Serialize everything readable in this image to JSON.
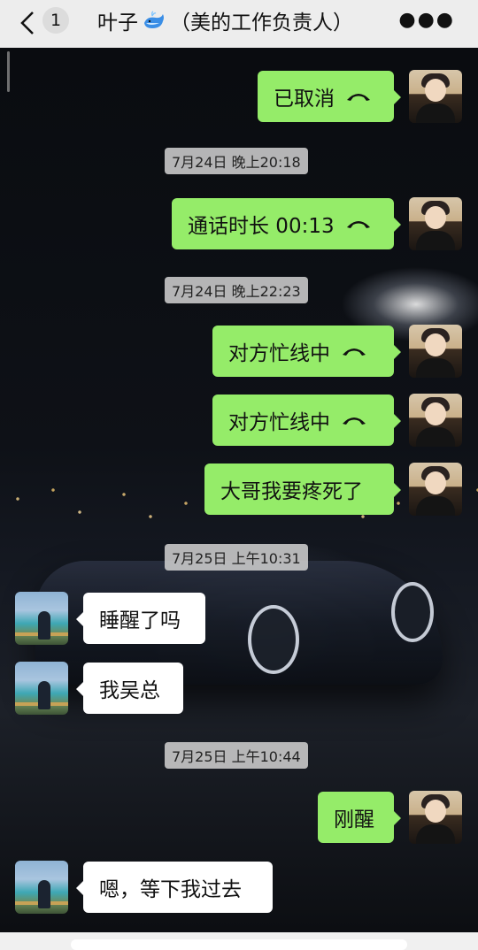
{
  "header": {
    "back_icon": "chevron-left-icon",
    "unread_count": "1",
    "title_name": "叶子",
    "title_emoji": "whale-icon",
    "title_note": "（美的工作负责人）",
    "more_icon": "ellipsis-icon"
  },
  "colors": {
    "self_bubble": "#95ec69",
    "other_bubble": "#ffffff",
    "timestamp_bg": "#cdcdcd",
    "header_bg": "#ededed"
  },
  "messages": [
    {
      "side": "right",
      "text": "已取消",
      "icon": "phone-hangup-icon"
    },
    {
      "stamp": "7月24日 晚上20:18"
    },
    {
      "side": "right",
      "text": "通话时长 00:13",
      "icon": "phone-hangup-icon"
    },
    {
      "stamp": "7月24日 晚上22:23"
    },
    {
      "side": "right",
      "text": "对方忙线中",
      "icon": "phone-hangup-icon"
    },
    {
      "side": "right",
      "text": "对方忙线中",
      "icon": "phone-hangup-icon"
    },
    {
      "side": "right",
      "text": "大哥我要疼死了"
    },
    {
      "stamp": "7月25日 上午10:31"
    },
    {
      "side": "left",
      "text": "睡醒了吗"
    },
    {
      "side": "left",
      "text": "我吴总"
    },
    {
      "stamp": "7月25日 上午10:44"
    },
    {
      "side": "right",
      "text": "刚醒"
    },
    {
      "side": "left",
      "text": "嗯，等下我过去"
    }
  ]
}
